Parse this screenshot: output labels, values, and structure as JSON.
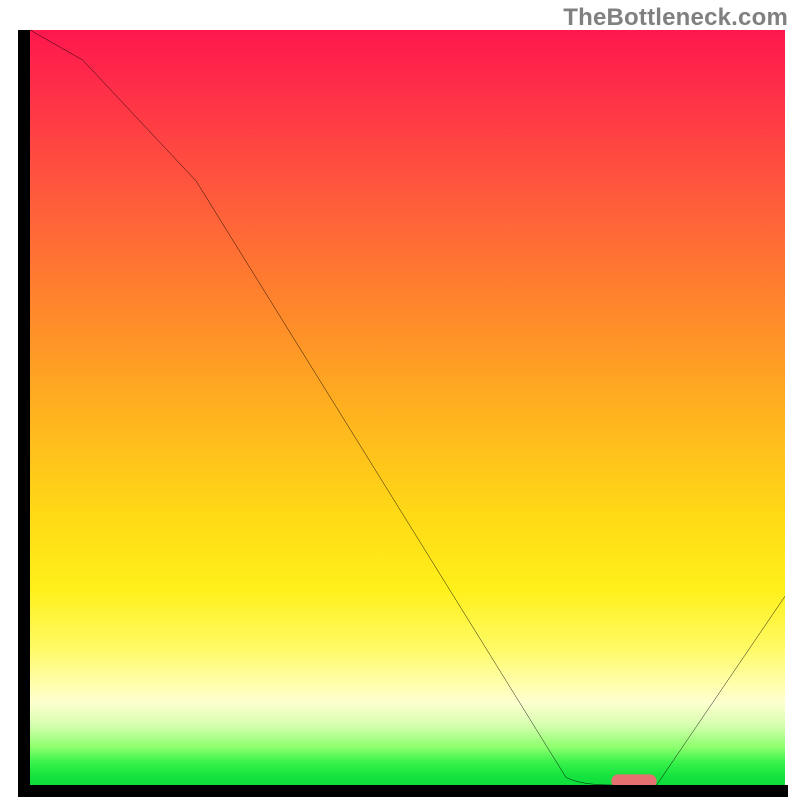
{
  "attribution": "TheBottleneck.com",
  "chart_data": {
    "type": "line",
    "title": "",
    "xlabel": "",
    "ylabel": "",
    "xlim": [
      0,
      100
    ],
    "ylim": [
      0,
      100
    ],
    "series": [
      {
        "name": "bottleneck-curve",
        "x": [
          0,
          7,
          22,
          71,
          77,
          83,
          100
        ],
        "values": [
          100,
          96,
          80,
          1,
          0,
          0,
          25
        ]
      }
    ],
    "marker": {
      "name": "optimal-range",
      "x_start": 77,
      "x_end": 83,
      "y": 0,
      "color": "#e4706f"
    },
    "background_gradient": {
      "stops": [
        {
          "pos": 0.0,
          "color": "#ff174e"
        },
        {
          "pos": 0.38,
          "color": "#ff8a2a"
        },
        {
          "pos": 0.74,
          "color": "#fff01a"
        },
        {
          "pos": 0.92,
          "color": "#d6ffb0"
        },
        {
          "pos": 1.0,
          "color": "#0ddd3b"
        }
      ]
    }
  }
}
